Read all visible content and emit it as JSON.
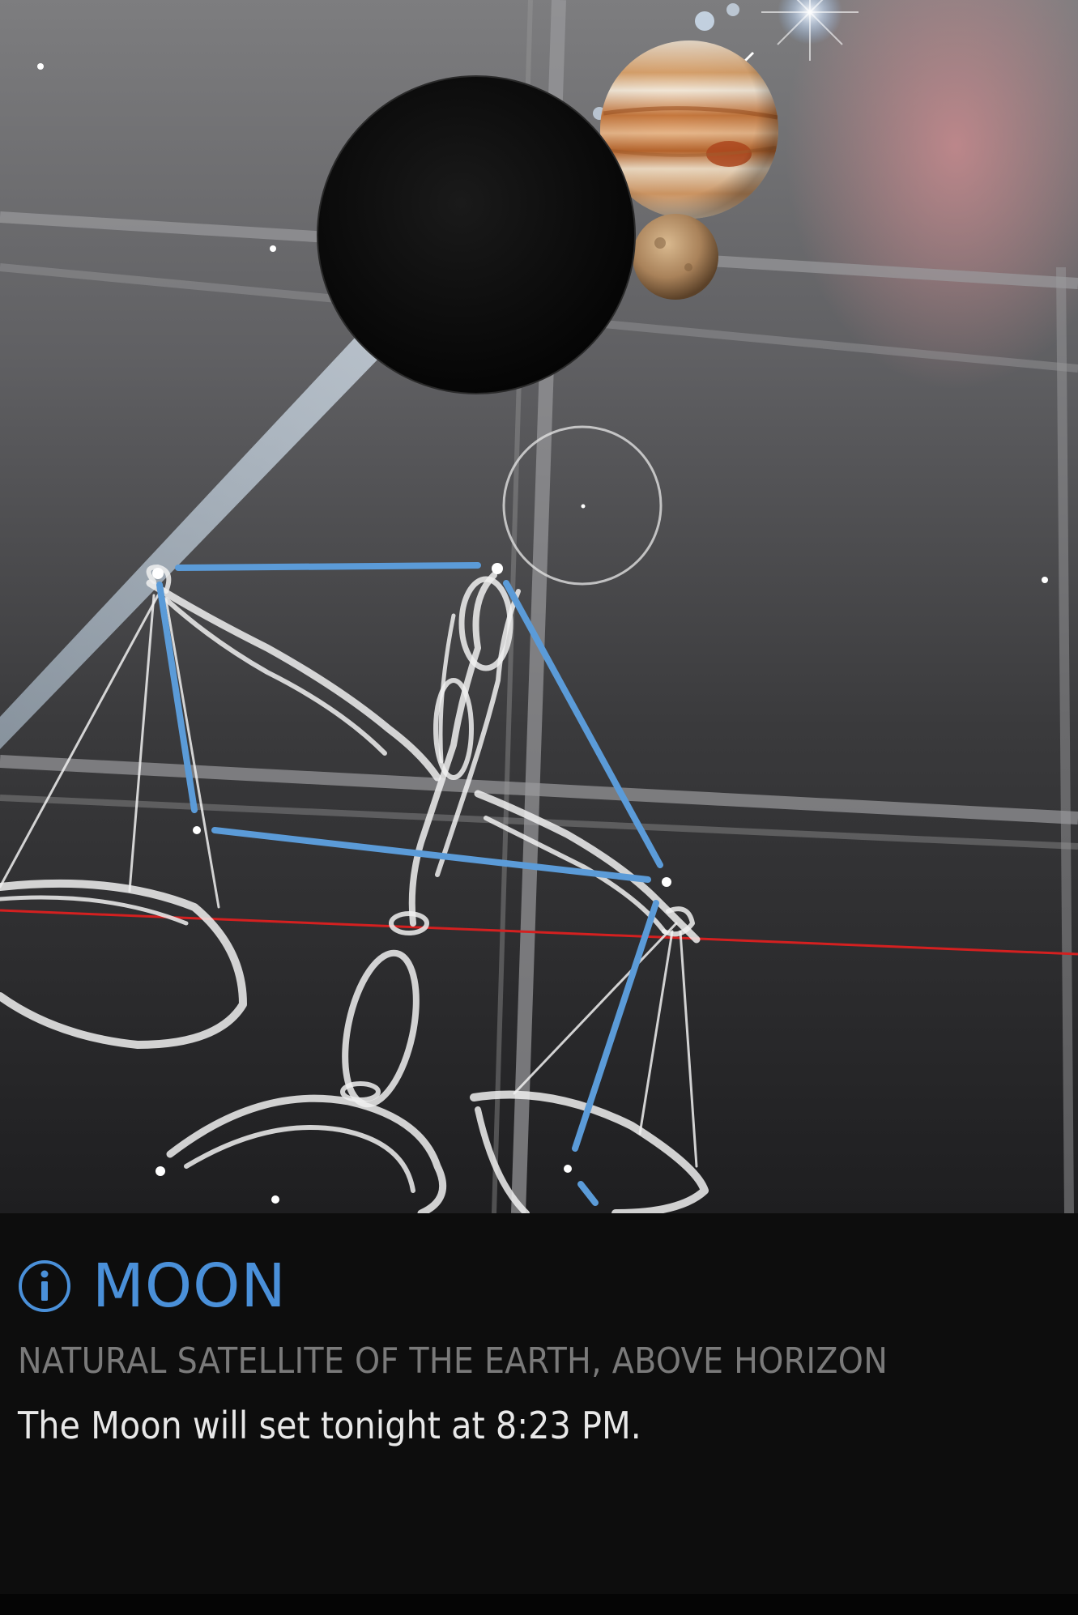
{
  "selected_object": {
    "name": "MOON",
    "subtitle": "NATURAL SATELLITE OF THE EARTH, ABOVE HORIZON",
    "description": "The Moon will set tonight at 8:23 PM."
  },
  "sky_objects": [
    "moon",
    "jupiter",
    "mercury",
    "libra-constellation"
  ],
  "icons": {
    "info": "info-circle-icon"
  },
  "colors": {
    "accent": "#4a90d9",
    "subtitle": "#7a7a7a",
    "description": "#e8e8e8",
    "horizon_line": "#d42020",
    "constellation_lines": "#5b9bd8"
  }
}
